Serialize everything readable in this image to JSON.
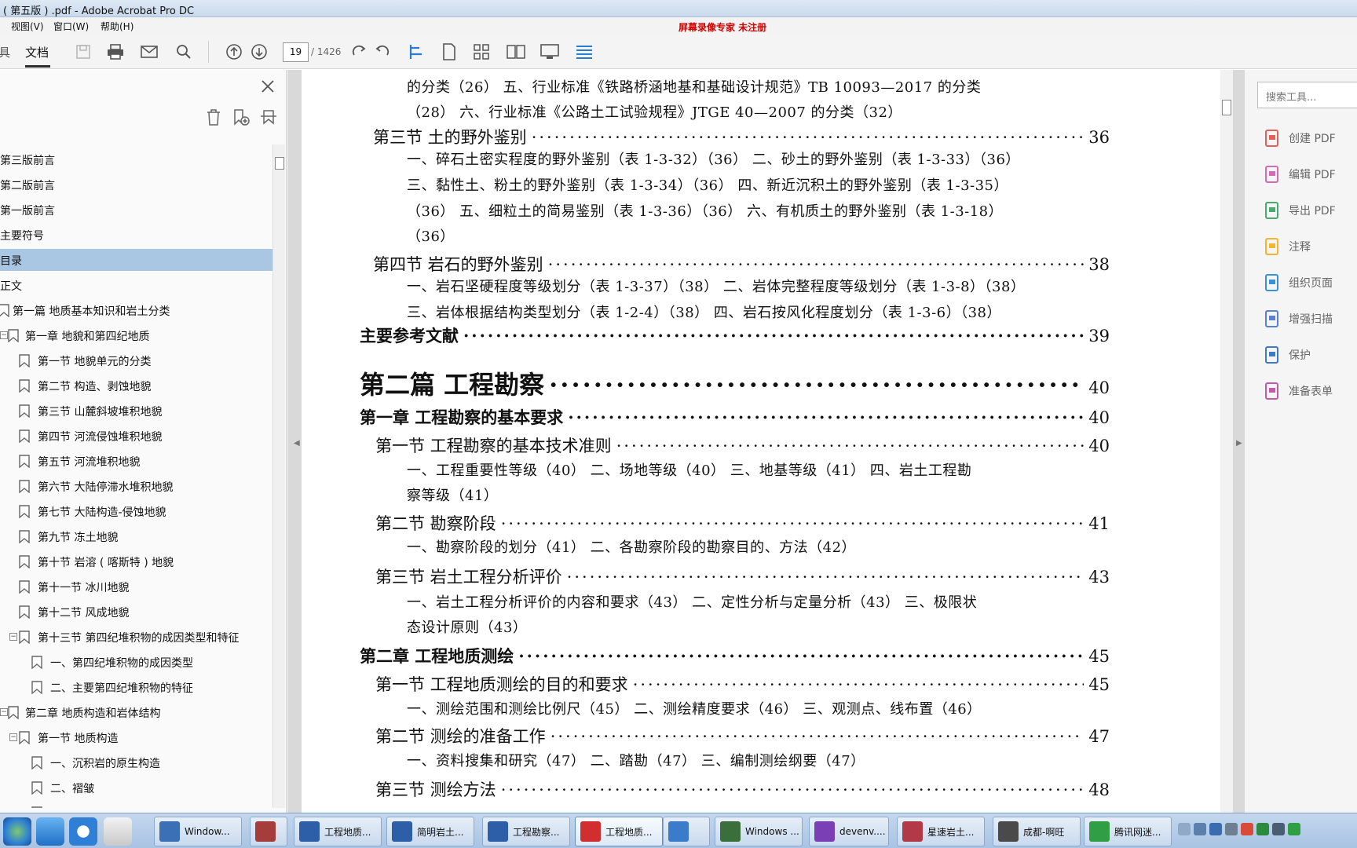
{
  "window": {
    "title": "( 第五版 ) .pdf - Adobe Acrobat Pro DC"
  },
  "menubar": {
    "items": [
      "视图(V)",
      "窗口(W)",
      "帮助(H)"
    ],
    "watermark": "屏幕录像专家  未注册"
  },
  "toolbar": {
    "tab_tools": "具",
    "tab_document": "文档",
    "page_number": "19",
    "page_total": "/ 1426"
  },
  "bookmarks": [
    {
      "label": "第三版前言",
      "level": 0,
      "selected": false,
      "twisty": false,
      "icon": false
    },
    {
      "label": "第二版前言",
      "level": 0,
      "selected": false,
      "twisty": false,
      "icon": false
    },
    {
      "label": "第一版前言",
      "level": 0,
      "selected": false,
      "twisty": false,
      "icon": false
    },
    {
      "label": "主要符号",
      "level": 0,
      "selected": false,
      "twisty": false,
      "icon": false
    },
    {
      "label": "目录",
      "level": 0,
      "selected": true,
      "twisty": false,
      "icon": false
    },
    {
      "label": "正文",
      "level": 0,
      "selected": false,
      "twisty": false,
      "icon": false
    },
    {
      "label": "第一篇 地质基本知识和岩土分类",
      "level": 0,
      "selected": false,
      "twisty": false,
      "icon": true
    },
    {
      "label": "第一章 地貌和第四纪地质",
      "level": 1,
      "selected": false,
      "twisty": true,
      "icon": true
    },
    {
      "label": "第一节 地貌单元的分类",
      "level": 2,
      "selected": false,
      "twisty": false,
      "icon": true
    },
    {
      "label": "第二节 构造、剥蚀地貌",
      "level": 2,
      "selected": false,
      "twisty": false,
      "icon": true
    },
    {
      "label": "第三节 山麓斜坡堆积地貌",
      "level": 2,
      "selected": false,
      "twisty": false,
      "icon": true
    },
    {
      "label": "第四节 河流侵蚀堆积地貌",
      "level": 2,
      "selected": false,
      "twisty": false,
      "icon": true
    },
    {
      "label": "第五节 河流堆积地貌",
      "level": 2,
      "selected": false,
      "twisty": false,
      "icon": true
    },
    {
      "label": "第六节 大陆停滞水堆积地貌",
      "level": 2,
      "selected": false,
      "twisty": false,
      "icon": true
    },
    {
      "label": "第七节 大陆构造-侵蚀地貌",
      "level": 2,
      "selected": false,
      "twisty": false,
      "icon": true
    },
    {
      "label": "第九节 冻土地貌",
      "level": 2,
      "selected": false,
      "twisty": false,
      "icon": true
    },
    {
      "label": "第十节 岩溶 ( 喀斯特 ) 地貌",
      "level": 2,
      "selected": false,
      "twisty": false,
      "icon": true
    },
    {
      "label": "第十一节 冰川地貌",
      "level": 2,
      "selected": false,
      "twisty": false,
      "icon": true
    },
    {
      "label": "第十二节 风成地貌",
      "level": 2,
      "selected": false,
      "twisty": false,
      "icon": true
    },
    {
      "label": "第十三节 第四纪堆积物的成因类型和特征",
      "level": 2,
      "selected": false,
      "twisty": true,
      "icon": true
    },
    {
      "label": "一、第四纪堆积物的成因类型",
      "level": 3,
      "selected": false,
      "twisty": false,
      "icon": true
    },
    {
      "label": "二、主要第四纪堆积物的特征",
      "level": 3,
      "selected": false,
      "twisty": false,
      "icon": true
    },
    {
      "label": "第二章 地质构造和岩体结构",
      "level": 1,
      "selected": false,
      "twisty": true,
      "icon": true
    },
    {
      "label": "第一节 地质构造",
      "level": 2,
      "selected": false,
      "twisty": true,
      "icon": true
    },
    {
      "label": "一、沉积岩的原生构造",
      "level": 3,
      "selected": false,
      "twisty": false,
      "icon": true
    },
    {
      "label": "二、褶皱",
      "level": 3,
      "selected": false,
      "twisty": false,
      "icon": true
    },
    {
      "label": "三、裂隙 ( 节理 )",
      "level": 3,
      "selected": false,
      "twisty": false,
      "icon": true
    }
  ],
  "document": {
    "lines": [
      {
        "type": "item",
        "text": "的分类（26）   五、行业标准《铁路桥涵地基和基础设计规范》TB 10093—2017 的分类"
      },
      {
        "type": "item",
        "text": "（28）   六、行业标准《公路土工试验规程》JTGE 40—2007 的分类（32）"
      },
      {
        "type": "sec",
        "text": "第三节   土的野外鉴别",
        "page": "36"
      },
      {
        "type": "item",
        "text": "一、碎石土密实程度的野外鉴别（表 1-3-32）（36）   二、砂土的野外鉴别（表 1-3-33）（36）"
      },
      {
        "type": "item",
        "text": "三、黏性土、粉土的野外鉴别（表 1-3-34）（36）   四、新近沉积土的野外鉴别（表 1-3-35）"
      },
      {
        "type": "item",
        "text": "（36）   五、细粒土的简易鉴别（表 1-3-36）（36）   六、有机质土的野外鉴别（表 1-3-18）"
      },
      {
        "type": "item",
        "text": "（36）"
      },
      {
        "type": "sec",
        "text": "第四节   岩石的野外鉴别",
        "page": "38"
      },
      {
        "type": "item",
        "text": "一、岩石坚硬程度等级划分（表 1-3-37）（38）   二、岩体完整程度等级划分（表 1-3-8）（38）"
      },
      {
        "type": "item",
        "text": "三、岩体根据结构类型划分（表 1-2-4）（38）   四、岩石按风化程度划分（表 1-3-6）（38）"
      },
      {
        "type": "chap",
        "text": "主要参考文献",
        "page": "39"
      },
      {
        "type": "part",
        "text": "第二篇   工程勘察",
        "page": "40"
      },
      {
        "type": "chap",
        "text": "第一章   工程勘察的基本要求",
        "page": "40"
      },
      {
        "type": "sec",
        "text": "第一节   工程勘察的基本技术准则",
        "page": "40"
      },
      {
        "type": "item",
        "text": "一、工程重要性等级（40）   二、场地等级（40）   三、地基等级（41）   四、岩土工程勘"
      },
      {
        "type": "item",
        "text": "察等级（41）"
      },
      {
        "type": "sec",
        "text": "第二节   勘察阶段",
        "page": "41"
      },
      {
        "type": "item",
        "text": "一、勘察阶段的划分（41）   二、各勘察阶段的勘察目的、方法（42）"
      },
      {
        "type": "sec",
        "text": "第三节   岩土工程分析评价",
        "page": "43"
      },
      {
        "type": "item",
        "text": "一、岩土工程分析评价的内容和要求（43）   二、定性分析与定量分析（43）   三、极限状"
      },
      {
        "type": "item",
        "text": "态设计原则（43）"
      },
      {
        "type": "chap",
        "text": "第二章   工程地质测绘",
        "page": "45"
      },
      {
        "type": "sec",
        "text": "第一节   工程地质测绘的目的和要求",
        "page": "45"
      },
      {
        "type": "item",
        "text": "一、测绘范围和测绘比例尺（45）   二、测绘精度要求（46）   三、观测点、线布置（46）"
      },
      {
        "type": "sec",
        "text": "第二节   测绘的准备工作",
        "page": "47"
      },
      {
        "type": "item",
        "text": "一、资料搜集和研究（47）   二、踏勘（47）   三、编制测绘纲要（47）"
      },
      {
        "type": "sec",
        "text": "第三节   测绘方法",
        "page": "48"
      }
    ]
  },
  "tools_panel": {
    "search_placeholder": "搜索工具...",
    "items": [
      {
        "label": "创建 PDF",
        "color": "#e0605a"
      },
      {
        "label": "编辑 PDF",
        "color": "#d36bb2"
      },
      {
        "label": "导出 PDF",
        "color": "#4aa96c"
      },
      {
        "label": "注释",
        "color": "#f2b531"
      },
      {
        "label": "组织页面",
        "color": "#3a8fd6"
      },
      {
        "label": "增强扫描",
        "color": "#5b7fd3"
      },
      {
        "label": "保护",
        "color": "#3e78c9"
      },
      {
        "label": "准备表单",
        "color": "#c25aa8"
      }
    ]
  },
  "taskbar": {
    "tasks": [
      {
        "label": "Window...",
        "icon_color": "#3b6fb6",
        "active": false
      },
      {
        "label": "",
        "icon_color": "#a63d3d",
        "active": false
      },
      {
        "label": "工程地质...",
        "icon_color": "#2c5fa8",
        "active": false
      },
      {
        "label": "简明岩土...",
        "icon_color": "#2c5fa8",
        "active": false
      },
      {
        "label": "工程勘察...",
        "icon_color": "#2c5fa8",
        "active": false
      },
      {
        "label": "工程地质...",
        "icon_color": "#d12f2f",
        "active": true
      },
      {
        "label": "",
        "icon_color": "#3a7cc9",
        "active": false
      },
      {
        "label": "Windows ...",
        "icon_color": "#3a6e3a",
        "active": false
      },
      {
        "label": "devenv....",
        "icon_color": "#7b3fb5",
        "active": false
      },
      {
        "label": "星速岩土...",
        "icon_color": "#b23a48",
        "active": false
      },
      {
        "label": "成都-啊旺",
        "icon_color": "#4a4a4a",
        "active": false
      },
      {
        "label": "腾讯网迷...",
        "icon_color": "#2f9e44",
        "active": false
      }
    ]
  }
}
